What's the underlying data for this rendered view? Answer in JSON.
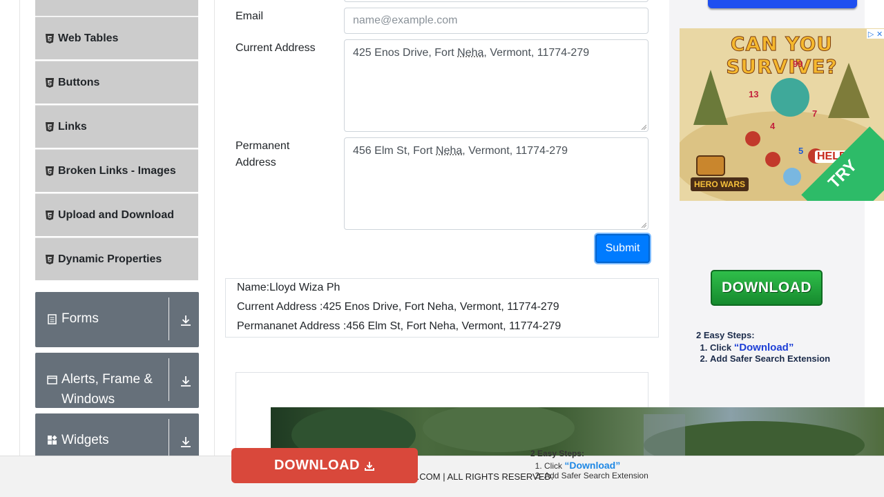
{
  "sidebar": {
    "items": [
      {
        "label": "Web Tables",
        "icon": "html5-icon"
      },
      {
        "label": "Buttons",
        "icon": "html5-icon"
      },
      {
        "label": "Links",
        "icon": "html5-icon"
      },
      {
        "label": "Broken Links - Images",
        "icon": "html5-icon"
      },
      {
        "label": "Upload and Download",
        "icon": "html5-icon"
      },
      {
        "label": "Dynamic Properties",
        "icon": "html5-icon"
      }
    ],
    "groups": [
      {
        "label": "Forms",
        "icon": "form-icon"
      },
      {
        "label": "Alerts, Frame & Windows",
        "icon": "window-icon"
      },
      {
        "label": "Widgets",
        "icon": "widgets-icon"
      }
    ]
  },
  "form": {
    "email_label": "Email",
    "email_placeholder": "name@example.com",
    "current_address_label": "Current Address",
    "current_address_pre": "425 Enos Drive, Fort ",
    "current_address_mark": "Neha",
    "current_address_post": ", Vermont, 11774-279",
    "permanent_address_label": "Permanent Address",
    "permanent_address_pre": "456 Elm St, Fort ",
    "permanent_address_mark": "Neha",
    "permanent_address_post": ", Vermont, 11774-279",
    "submit_label": "Submit"
  },
  "output": {
    "name": "Name:Lloyd Wiza Ph",
    "current_address": "Current Address :425 Enos Drive, Fort Neha, Vermont, 11774-279",
    "permanent_address": "Permananet Address :456 Elm St, Fort Neha, Vermont, 11774-279"
  },
  "ads": {
    "banner_title": "CAN YOU SURVIVE?",
    "banner_numbers": [
      "99",
      "13",
      "7",
      "4",
      "5"
    ],
    "banner_help": "HELP!",
    "banner_brand": "HERO WARS",
    "banner_cta": "TRY",
    "download_label": "DOWNLOAD",
    "steps_title": "2 Easy Steps:",
    "steps_1_prefix": "Click ",
    "steps_1_link": "“Download”",
    "steps_2": "Add Safer Search Extension",
    "bottom_download_label": "DOWNLOAD",
    "bottom_steps_title": "2 Easy Steps:",
    "bottom_steps_1_prefix": "Click ",
    "bottom_steps_1_link": "“Download”",
    "bottom_steps_2": "Add Safer Search Extension",
    "ad_choice_label": "▷",
    "ad_close_label": "✕"
  },
  "footer": {
    "text": "A.COM | ALL RIGHTS RESERVED."
  },
  "colors": {
    "sidebar_item_bg": "#cccccc",
    "group_bg": "#66707a",
    "submit_bg": "#007bff",
    "ad_download_green": "#2fbe4a",
    "bottom_download_red": "#d9483b"
  }
}
